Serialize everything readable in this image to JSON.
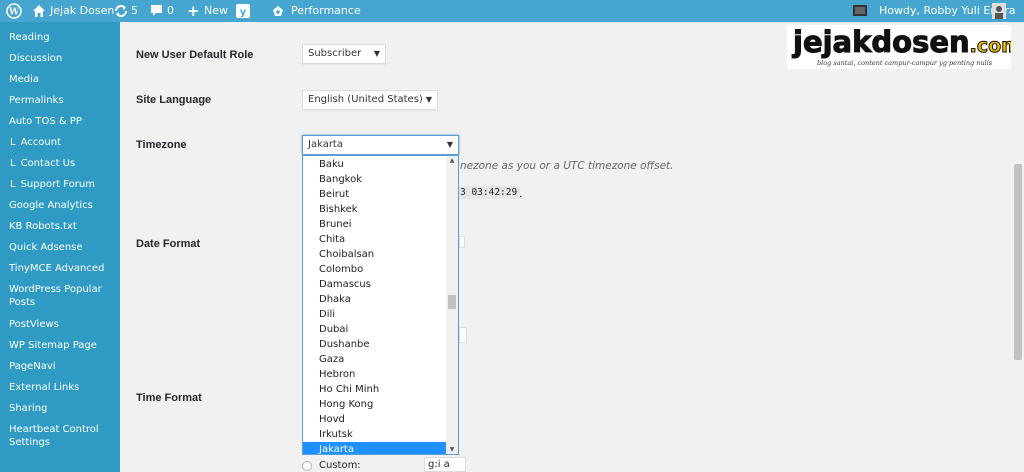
{
  "admin_bar": {
    "site_name": "Jejak Dosen",
    "updates_count": "5",
    "comments_count": "0",
    "new_label": "New",
    "performance_label": "Performance",
    "greeting": "Howdy, Robby Yuli Endra"
  },
  "sidebar": {
    "items": [
      {
        "label": "Reading"
      },
      {
        "label": "Discussion"
      },
      {
        "label": "Media"
      },
      {
        "label": "Permalinks"
      },
      {
        "label": "Auto TOS & PP"
      },
      {
        "label": "Account"
      },
      {
        "label": "Contact Us"
      },
      {
        "label": "Support Forum"
      },
      {
        "label": "Google Analytics"
      },
      {
        "label": "KB Robots.txt"
      },
      {
        "label": "Quick Adsense"
      },
      {
        "label": "TinyMCE Advanced"
      },
      {
        "label": "WordPress Popular Posts"
      },
      {
        "label": "PostViews"
      },
      {
        "label": "WP Sitemap Page"
      },
      {
        "label": "PageNavi"
      },
      {
        "label": "External Links"
      },
      {
        "label": "Sharing"
      },
      {
        "label": "Heartbeat Control Settings"
      }
    ],
    "sub_prefix": "L"
  },
  "settings": {
    "default_role_label": "New User Default Role",
    "default_role_value": "Subscriber",
    "site_language_label": "Site Language",
    "site_language_value": "English (United States)",
    "timezone_label": "Timezone",
    "timezone_value": "Jakarta",
    "timezone_hint": "nezone as you or a UTC timezone offset.",
    "time_snippet": "3 03:42:29",
    "time_snippet_dot": ".",
    "date_format_label": "Date Format",
    "time_format_label": "Time Format",
    "custom_label": "Custom:",
    "custom_value": "g:i a"
  },
  "timezone_options": [
    "Baku",
    "Bangkok",
    "Beirut",
    "Bishkek",
    "Brunei",
    "Chita",
    "Choibalsan",
    "Colombo",
    "Damascus",
    "Dhaka",
    "Dili",
    "Dubai",
    "Dushanbe",
    "Gaza",
    "Hebron",
    "Ho Chi Minh",
    "Hong Kong",
    "Hovd",
    "Irkutsk",
    "Jakarta"
  ],
  "logo": {
    "main": "jejakdosen",
    "suffix": ".com",
    "tagline": "blog santai, content campur-campur yg penting nulis"
  },
  "colors": {
    "admin_bar": "#47a6cf",
    "sidebar": "#2f9bc4",
    "selected_option": "#1e90ff",
    "logo_accent": "#f2c200"
  }
}
